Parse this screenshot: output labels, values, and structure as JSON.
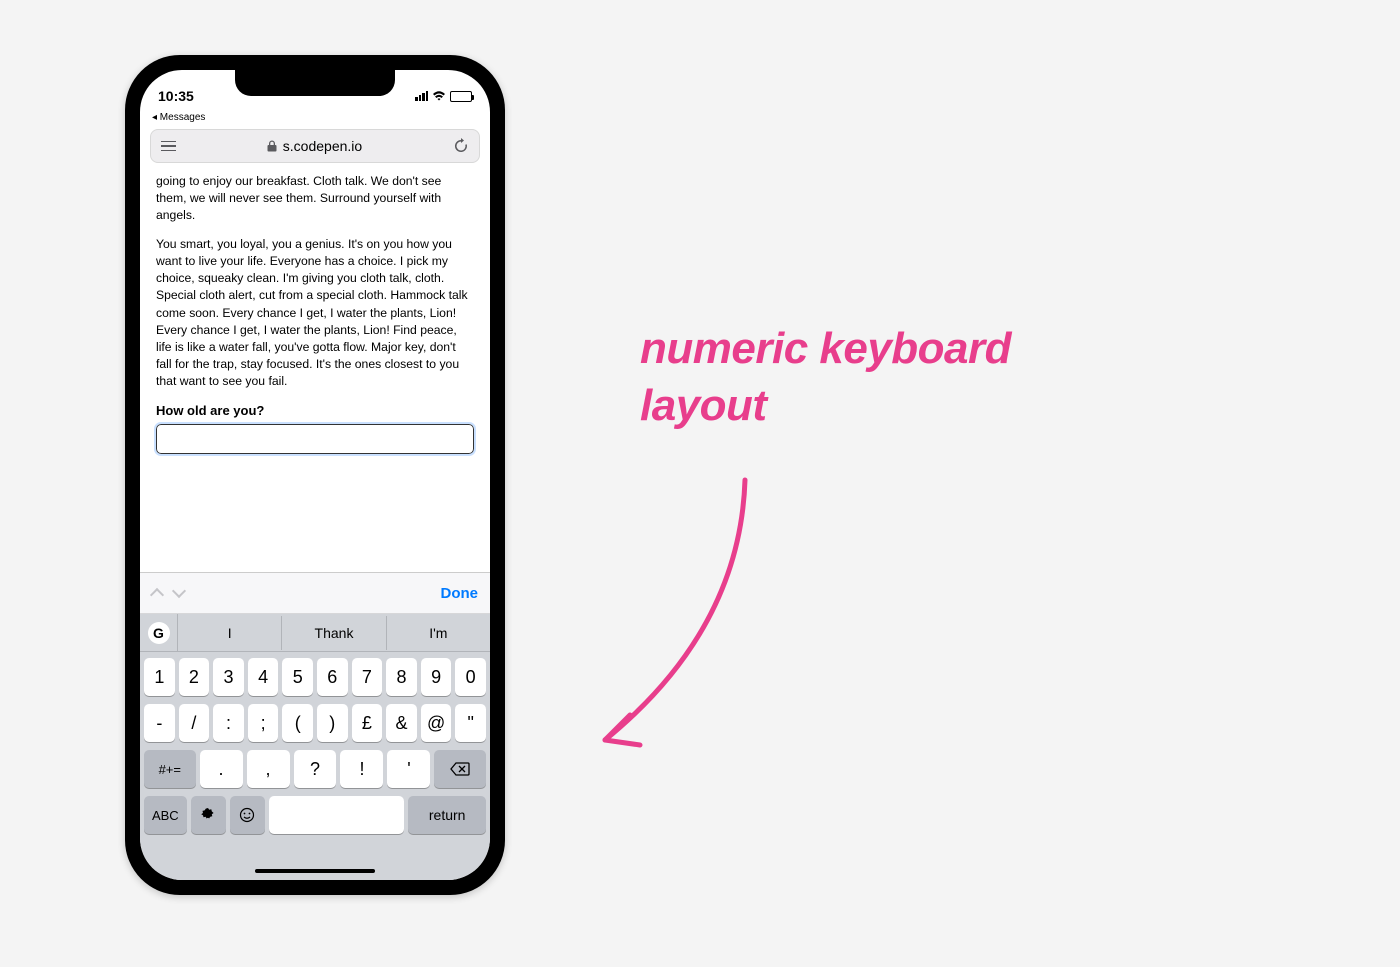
{
  "status": {
    "time": "10:35",
    "back": "◂ Messages"
  },
  "browser": {
    "url": "s.codepen.io"
  },
  "page": {
    "p1": "going to enjoy our breakfast. Cloth talk. We don't see them, we will never see them. Surround yourself with angels.",
    "p2": "You smart, you loyal, you a genius. It's on you how you want to live your life. Everyone has a choice. I pick my choice, squeaky clean. I'm giving you cloth talk, cloth. Special cloth alert, cut from a special cloth. Hammock talk come soon. Every chance I get, I water the plants, Lion! Every chance I get, I water the plants, Lion! Find peace, life is like a water fall, you've gotta flow. Major key, don't fall for the trap, stay focused. It's the ones closest to you that want to see you fail.",
    "label": "How old are you?",
    "input_value": ""
  },
  "accessory": {
    "done": "Done"
  },
  "suggestions": {
    "g": "G",
    "s1": "I",
    "s2": "Thank",
    "s3": "I'm"
  },
  "keys": {
    "r1": [
      "1",
      "2",
      "3",
      "4",
      "5",
      "6",
      "7",
      "8",
      "9",
      "0"
    ],
    "r2": [
      "-",
      "/",
      ":",
      ";",
      "(",
      ")",
      "£",
      "&",
      "@",
      "\""
    ],
    "sym": "#+=",
    "r3": [
      ".",
      ",",
      "?",
      "!",
      "'"
    ],
    "abc": "ABC",
    "return": "return"
  },
  "annotation": {
    "line1": "numeric keyboard",
    "line2": "layout"
  }
}
